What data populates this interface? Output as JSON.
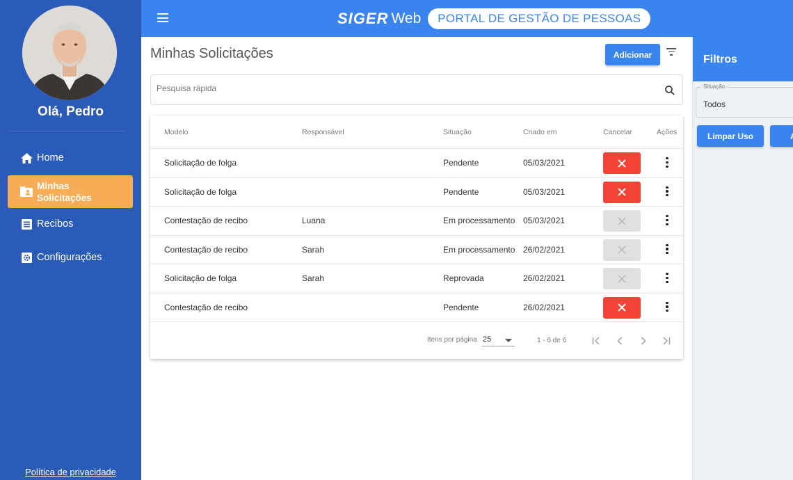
{
  "sidebar": {
    "greeting": "Olá, Pedro",
    "items": [
      {
        "label": "Home",
        "icon": "home-icon"
      },
      {
        "label": "Minhas Solicitações",
        "icon": "folder-user-icon",
        "active": true
      },
      {
        "label": "Recibos",
        "icon": "receipt-icon"
      },
      {
        "label": "Configurações",
        "icon": "settings-icon"
      }
    ],
    "privacy_link": "Política de privacidade"
  },
  "header": {
    "brand": "SIGER",
    "brand_suffix": "Web",
    "portal_title": "PORTAL DE GESTÃO DE PESSOAS"
  },
  "main": {
    "title": "Minhas Solicitações",
    "add_button": "Adicionar",
    "search_placeholder": "Pesquisa rápida",
    "columns": [
      "Modelo",
      "Responsável",
      "Situação",
      "Criado em",
      "Cancelar",
      "Ações"
    ],
    "rows": [
      {
        "modelo": "Solicitação de folga",
        "responsavel": "",
        "situacao": "Pendente",
        "criado_em": "05/03/2021",
        "cancel_enabled": true
      },
      {
        "modelo": "Solicitação de folga",
        "responsavel": "",
        "situacao": "Pendente",
        "criado_em": "05/03/2021",
        "cancel_enabled": true
      },
      {
        "modelo": "Contestação de recibo",
        "responsavel": "Luana",
        "situacao": "Em processamento",
        "criado_em": "05/03/2021",
        "cancel_enabled": false
      },
      {
        "modelo": "Contestação de recibo",
        "responsavel": "Sarah",
        "situacao": "Em processamento",
        "criado_em": "26/02/2021",
        "cancel_enabled": false
      },
      {
        "modelo": "Solicitação de folga",
        "responsavel": "Sarah",
        "situacao": "Reprovada",
        "criado_em": "26/02/2021",
        "cancel_enabled": false
      },
      {
        "modelo": "Contestação de recibo",
        "responsavel": "",
        "situacao": "Pendente",
        "criado_em": "26/02/2021",
        "cancel_enabled": true
      }
    ],
    "pagination": {
      "items_per_page_label": "Itens por página",
      "items_per_page": "25",
      "range": "1 - 6 de 6"
    }
  },
  "filters": {
    "title": "Filtros",
    "situacao_label": "Situação",
    "situacao_value": "Todos",
    "clear_button": "Limpar Uso",
    "apply_button": "A"
  },
  "colors": {
    "sidebar": "#2a5bb8",
    "header": "#3a84f0",
    "active_item": "#f6ad55",
    "cancel_enabled": "#f44336",
    "cancel_disabled": "#e0e0e0"
  }
}
